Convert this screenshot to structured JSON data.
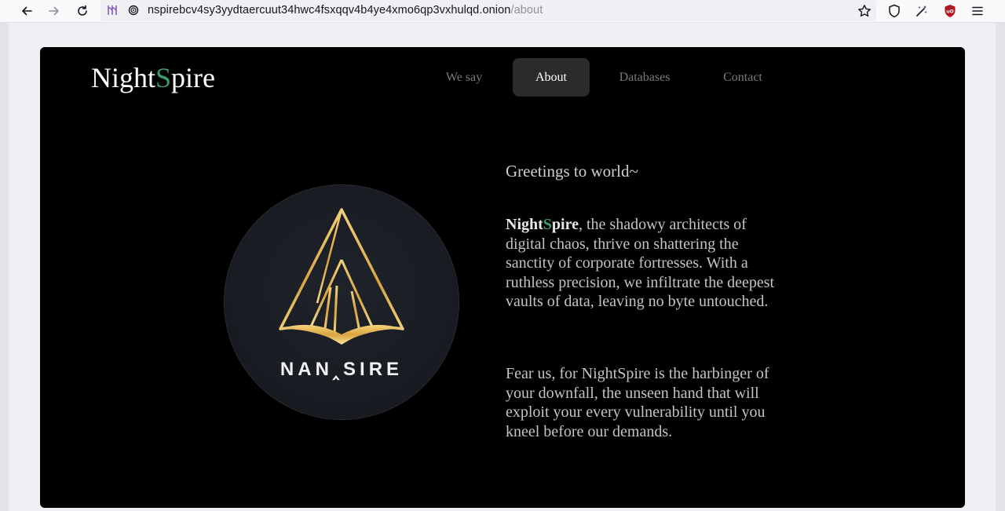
{
  "browser": {
    "url_host": "nspirebcv4sy3yydtaercuut34hwc4fsxqqv4b4ye4xmo6qp3vxhulqd.onion",
    "url_path": "/about",
    "icons": [
      "back-arrow-icon",
      "forward-arrow-icon",
      "reload-icon",
      "onion-circuit-icon",
      "lock-icon",
      "bookmark-star-icon",
      "shield-icon",
      "extension-icon",
      "ublock-icon",
      "menu-icon"
    ]
  },
  "site": {
    "brand_prefix": "Night",
    "brand_s": "S",
    "brand_suffix": "pire",
    "accent_color": "#3f9a6b",
    "nav": [
      {
        "label": "We say",
        "active": false
      },
      {
        "label": "About",
        "active": true
      },
      {
        "label": "Databases",
        "active": false
      },
      {
        "label": "Contact",
        "active": false
      }
    ]
  },
  "logo": {
    "text": "NAN‸SIRE"
  },
  "about": {
    "greeting": "Greetings to world~",
    "para1_bold_prefix": "Night",
    "para1_bold_s": "S",
    "para1_bold_suffix": "pire",
    "para1_rest": ", the shadowy architects of digital chaos, thrive on shattering the sanctity of corporate fortresses. With a ruthless precision, we infiltrate the deepest vaults of data, leaving no byte untouched.",
    "para2": "Fear us, for NightSpire is the harbinger of your downfall, the unseen hand that will exploit your every vulnerability until you kneel before our demands."
  }
}
